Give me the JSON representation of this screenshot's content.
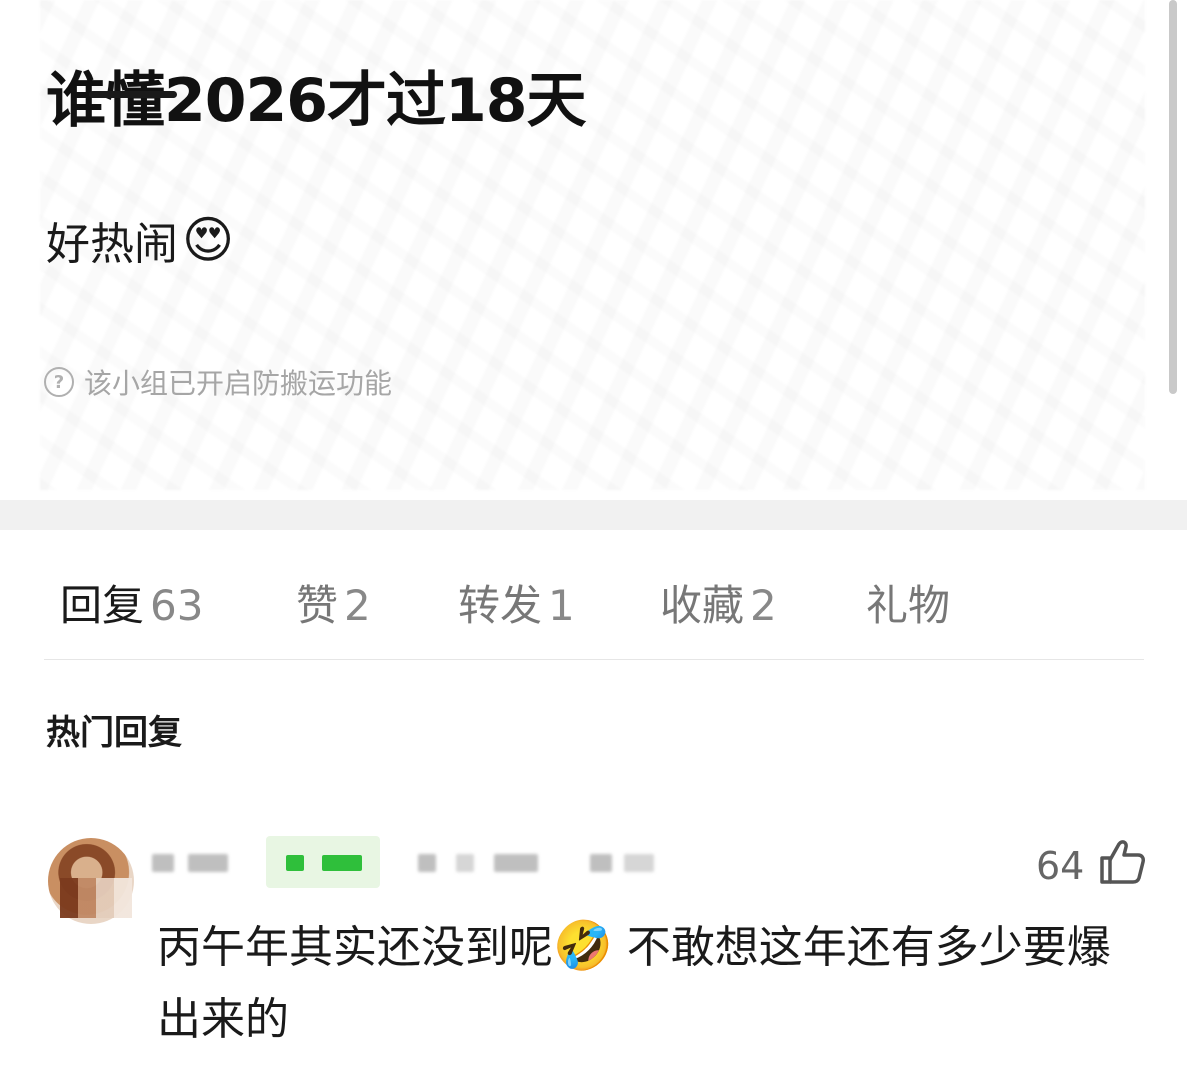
{
  "post": {
    "title": "谁懂2026才过18天",
    "body_text": "好热闹",
    "body_emoji": "😍",
    "anti_copy_notice": "该小组已开启防搬运功能"
  },
  "tabs": [
    {
      "label": "回复",
      "count": "63",
      "active": true
    },
    {
      "label": "赞",
      "count": "2",
      "active": false
    },
    {
      "label": "转发",
      "count": "1",
      "active": false
    },
    {
      "label": "收藏",
      "count": "2",
      "active": false
    },
    {
      "label": "礼物",
      "count": "",
      "active": false
    }
  ],
  "section_title": "热门回复",
  "comment": {
    "like_count": "64",
    "text_part1": "丙午年其实还没到呢",
    "emoji": "🤣",
    "text_part2": " 不敢想这年还有多少要爆出来的"
  },
  "icons": {
    "help": "question-circle-icon",
    "like": "thumbs-up-icon"
  },
  "colors": {
    "text_primary": "#1a1a1a",
    "text_secondary": "#777777",
    "badge_green": "#2fbf3b",
    "divider_band": "#f1f1f1"
  }
}
